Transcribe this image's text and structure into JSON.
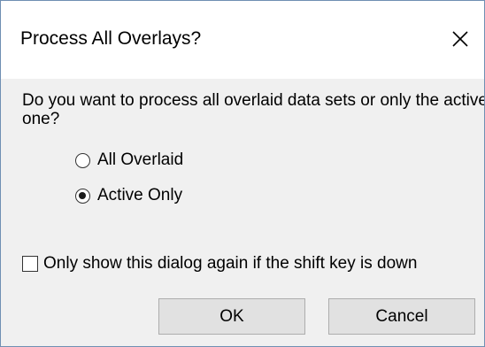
{
  "dialog": {
    "title": "Process All Overlays?",
    "question": "Do you want to process all overlaid data sets or only the active one?",
    "options": [
      {
        "label": "All Overlaid",
        "selected": false
      },
      {
        "label": "Active Only",
        "selected": true
      }
    ],
    "checkbox": {
      "label": "Only show this dialog again if the shift key is down",
      "checked": false
    },
    "buttons": {
      "ok_label": "OK",
      "cancel_label": "Cancel"
    },
    "close_icon": "close-icon"
  }
}
